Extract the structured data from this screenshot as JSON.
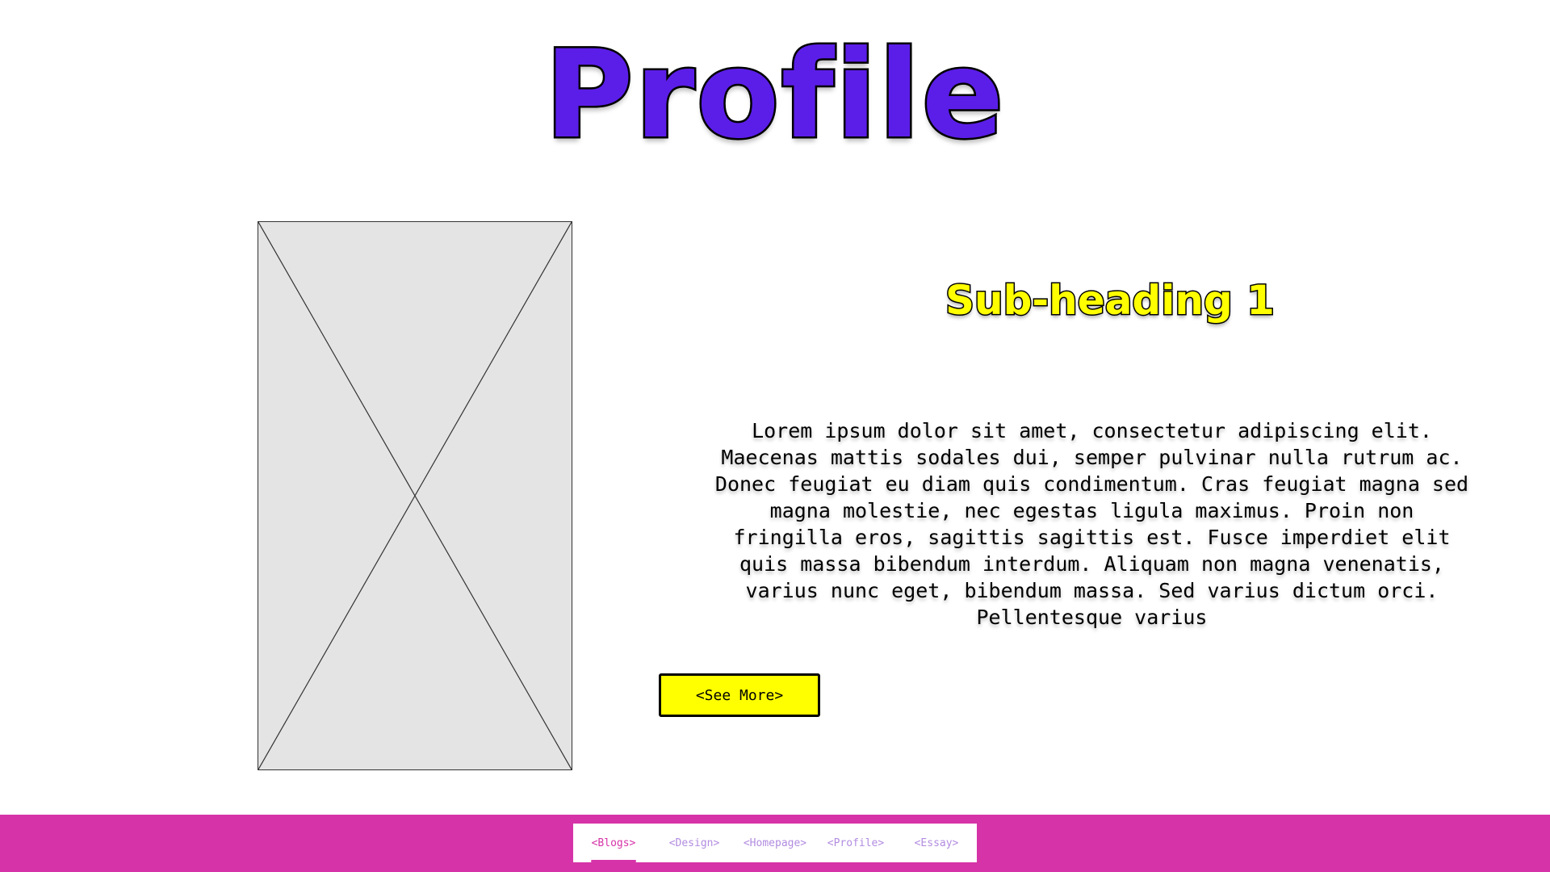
{
  "page": {
    "title": "Profile"
  },
  "image": {
    "placeholder_icon": "image-placeholder-cross-icon"
  },
  "content": {
    "subheading": "Sub-heading 1",
    "paragraph": "Lorem ipsum dolor sit amet, consectetur adipiscing elit. Maecenas mattis sodales dui, semper pulvinar nulla rutrum ac. Donec feugiat eu diam quis condimentum. Cras feugiat magna sed magna molestie, nec egestas ligula maximus. Proin non fringilla eros, sagittis sagittis est. Fusce imperdiet elit quis massa bibendum interdum. Aliquam non magna venenatis, varius nunc eget, bibendum massa. Sed varius dictum orci. Pellentesque varius",
    "see_more_label": "<See More>"
  },
  "nav": {
    "items": [
      {
        "label": "<Blogs>",
        "active": true
      },
      {
        "label": "<Design>",
        "active": false
      },
      {
        "label": "<Homepage>",
        "active": false
      },
      {
        "label": "<Profile>",
        "active": false
      },
      {
        "label": "<Essay>",
        "active": false
      }
    ]
  },
  "colors": {
    "title": "#5b1ee8",
    "subheading": "#ffff00",
    "button": "#ffff00",
    "footer": "#d633a8",
    "nav_active": "#d633a8",
    "nav_inactive": "#b28ce0",
    "placeholder": "#e4e4e4"
  }
}
